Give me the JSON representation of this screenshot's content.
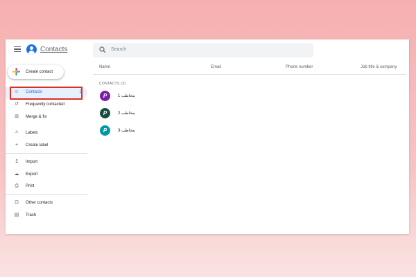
{
  "header": {
    "app_title": "Contacts",
    "search_placeholder": "Search"
  },
  "sidebar": {
    "create_label": "Create contact",
    "items": [
      {
        "label": "Contacts",
        "count": "3",
        "icon": "person-icon",
        "active": true
      },
      {
        "label": "Frequently contacted",
        "icon": "history-icon"
      },
      {
        "label": "Merge & fix",
        "icon": "merge-icon"
      },
      {
        "label": "Labels",
        "icon": "chevron-up-icon"
      },
      {
        "label": "Create label",
        "icon": "plus-icon"
      },
      {
        "label": "Import",
        "icon": "upload-icon"
      },
      {
        "label": "Export",
        "icon": "cloud-icon"
      },
      {
        "label": "Print",
        "icon": "printer-icon"
      },
      {
        "label": "Other contacts",
        "icon": "archive-icon"
      },
      {
        "label": "Trash",
        "icon": "trash-icon"
      }
    ]
  },
  "table": {
    "columns": [
      "Name",
      "Email",
      "Phone number",
      "Job title & company"
    ],
    "section_label": "CONTACTS (3)",
    "rows": [
      {
        "avatar": "P",
        "name": "مخاطب 1",
        "color": "#7b1fa2"
      },
      {
        "avatar": "P",
        "name": "مخاطب 2",
        "color": "#1b4d3e"
      },
      {
        "avatar": "P",
        "name": "مخاطب 3",
        "color": "#0097a7"
      }
    ]
  },
  "colors": {
    "accent": "#1a73e8",
    "highlight": "#d93025"
  }
}
